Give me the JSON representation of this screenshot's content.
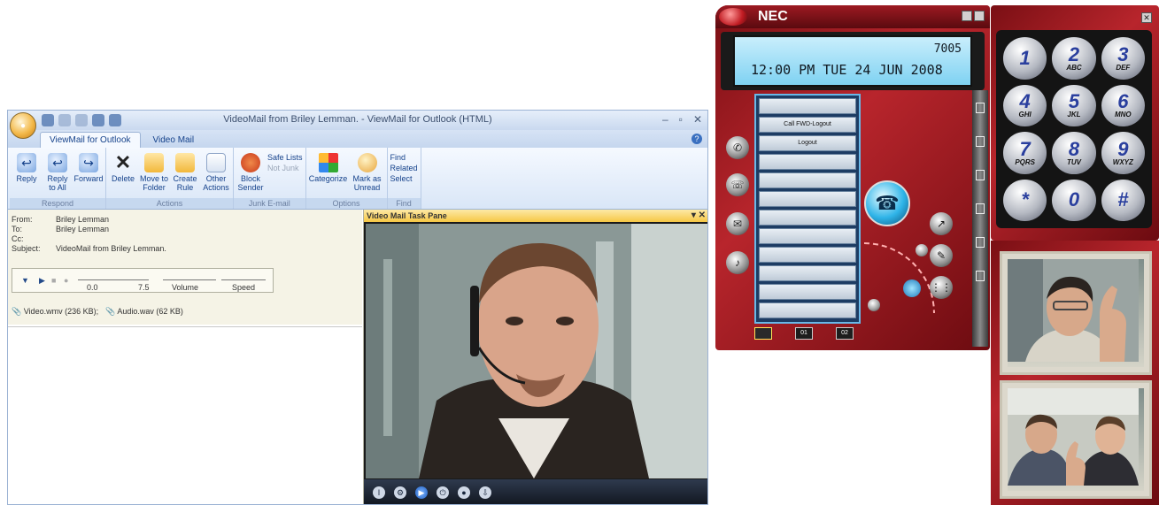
{
  "outlook": {
    "title": "VideoMail from Briley Lemman. - ViewMail for Outlook (HTML)",
    "window_controls": [
      "–",
      "▫",
      "✕"
    ],
    "tabs": [
      {
        "label": "ViewMail for Outlook",
        "active": true
      },
      {
        "label": "Video Mail",
        "active": false
      }
    ],
    "ribbon": {
      "respond": {
        "label": "Respond",
        "buttons": [
          "Reply",
          "Reply to All",
          "Forward"
        ]
      },
      "actions": {
        "label": "Actions",
        "buttons": [
          "Delete",
          "Move to Folder",
          "Create Rule",
          "Other Actions"
        ]
      },
      "junk": {
        "label": "Junk E-mail",
        "block": "Block Sender",
        "safe_lists": "Safe Lists",
        "not_junk": "Not Junk"
      },
      "options": {
        "label": "Options",
        "categorize": "Categorize",
        "mark_unread": "Mark as Unread"
      },
      "find": {
        "label": "Find",
        "find": "Find",
        "related": "Related",
        "select": "Select"
      }
    },
    "header": {
      "from_label": "From:",
      "from": "Briley Lemman",
      "to_label": "To:",
      "to": "Briley Lemman",
      "cc_label": "Cc:",
      "cc": "",
      "subject_label": "Subject:",
      "subject": "VideoMail from Briley Lemman."
    },
    "player": {
      "position": "0.0",
      "duration": "7.5",
      "volume_label": "Volume",
      "speed_label": "Speed"
    },
    "attachments": [
      "Video.wmv (236 KB);",
      "Audio.wav (62 KB)"
    ],
    "task_pane": {
      "title": "Video Mail Task Pane"
    }
  },
  "nec": {
    "brand": "NEC",
    "lcd": {
      "extension": "7005",
      "datetime": "12:00 PM TUE 24 JUN 2008"
    },
    "line_keys": [
      "",
      "Call FWD-Logout",
      "Logout",
      "",
      "",
      "",
      "",
      "",
      "",
      "",
      "",
      ""
    ],
    "bottom_labels": [
      "",
      "01",
      "02"
    ]
  },
  "keypad": {
    "keys": [
      {
        "digit": "1",
        "letters": ""
      },
      {
        "digit": "2",
        "letters": "ABC"
      },
      {
        "digit": "3",
        "letters": "DEF"
      },
      {
        "digit": "4",
        "letters": "GHI"
      },
      {
        "digit": "5",
        "letters": "JKL"
      },
      {
        "digit": "6",
        "letters": "MNO"
      },
      {
        "digit": "7",
        "letters": "PQRS"
      },
      {
        "digit": "8",
        "letters": "TUV"
      },
      {
        "digit": "9",
        "letters": "WXYZ"
      },
      {
        "digit": "*",
        "letters": ""
      },
      {
        "digit": "0",
        "letters": ""
      },
      {
        "digit": "#",
        "letters": ""
      }
    ]
  },
  "colors": {
    "nec_red": "#b8252c",
    "lcd_blue": "#7fd2f2",
    "ribbon_blue": "#d9e6f7",
    "task_pane_gold": "#f6c744"
  }
}
